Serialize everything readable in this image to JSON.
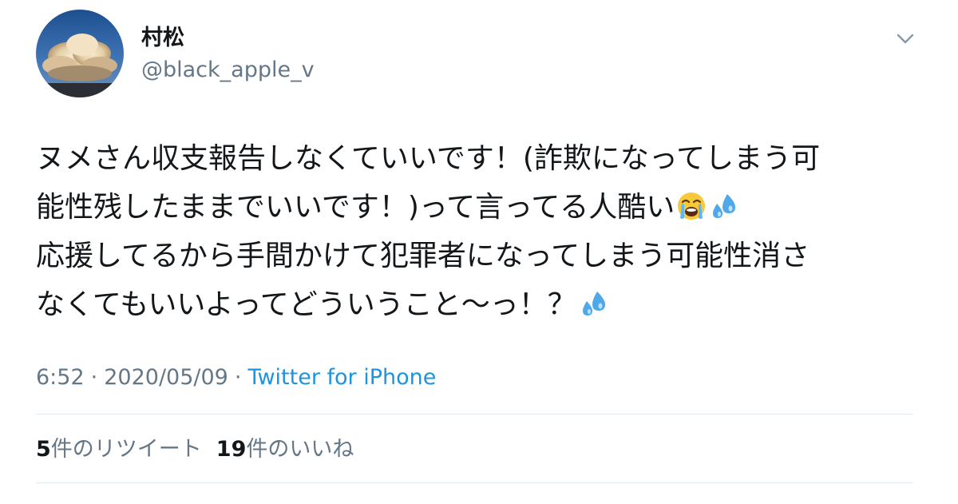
{
  "author": {
    "display_name": "村松",
    "handle": "@black_apple_v"
  },
  "tweet": {
    "lines": [
      "ヌメさん収支報告しなくていいです！(詐欺になってしまう可",
      "能性残したままでいいです！)って言ってる人酷い",
      "応援してるから手間かけて犯罪者になってしまう可能性消さ",
      "なくてもいいよってどういうこと〜っ！？"
    ],
    "emojis": [
      "loudly-crying-face",
      "sweat-droplets"
    ]
  },
  "meta": {
    "time": "6:52",
    "separator": "·",
    "date": "2020/05/09",
    "source": "Twitter for iPhone"
  },
  "stats": {
    "retweets_count": "5",
    "retweets_label": "件のリツイート",
    "likes_count": "19",
    "likes_label": "件のいいね"
  },
  "colors": {
    "text": "#14171a",
    "secondary": "#657786",
    "link": "#1b95e0",
    "divider": "#e1e8ed"
  }
}
